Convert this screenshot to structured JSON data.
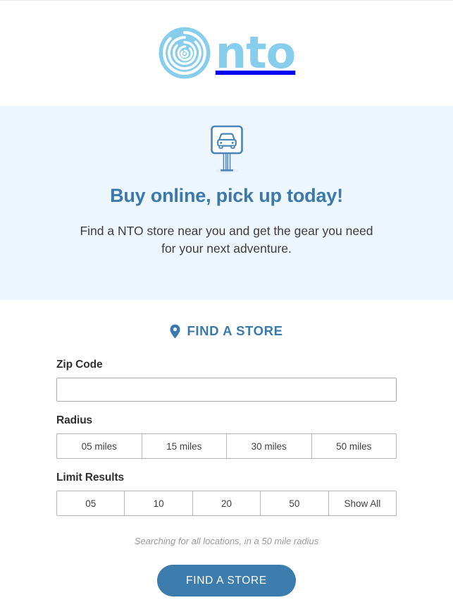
{
  "colors": {
    "brand_light_blue": "#87cdec",
    "brand_blue": "#3a79ac",
    "button_blue": "#3d7dad",
    "hero_background": "#edf5fd",
    "page_background": "#ffffff",
    "muted_text": "#9a9a9a",
    "border_gray": "#b5b5b5"
  },
  "header": {
    "logo_mark_name": "nto-concentric-circles-logo",
    "logo_wordmark": "nto"
  },
  "hero": {
    "icon_name": "car-pickup-sign-icon",
    "title": "Buy online, pick up today!",
    "subtitle": "Find a NTO store near you and get the gear you need for your next adventure."
  },
  "finder": {
    "heading_icon_name": "map-pin-icon",
    "heading": "FIND A STORE",
    "zip": {
      "label": "Zip Code",
      "value": "",
      "placeholder": ""
    },
    "radius": {
      "label": "Radius",
      "options": [
        "05 miles",
        "15 miles",
        "30 miles",
        "50 miles"
      ],
      "selected": "50 miles"
    },
    "limit": {
      "label": "Limit Results",
      "options": [
        "05",
        "10",
        "20",
        "50",
        "Show All"
      ],
      "selected": "Show All"
    },
    "status_note": "Searching for all locations, in a 50 mile radius",
    "submit_label": "FIND A STORE"
  }
}
